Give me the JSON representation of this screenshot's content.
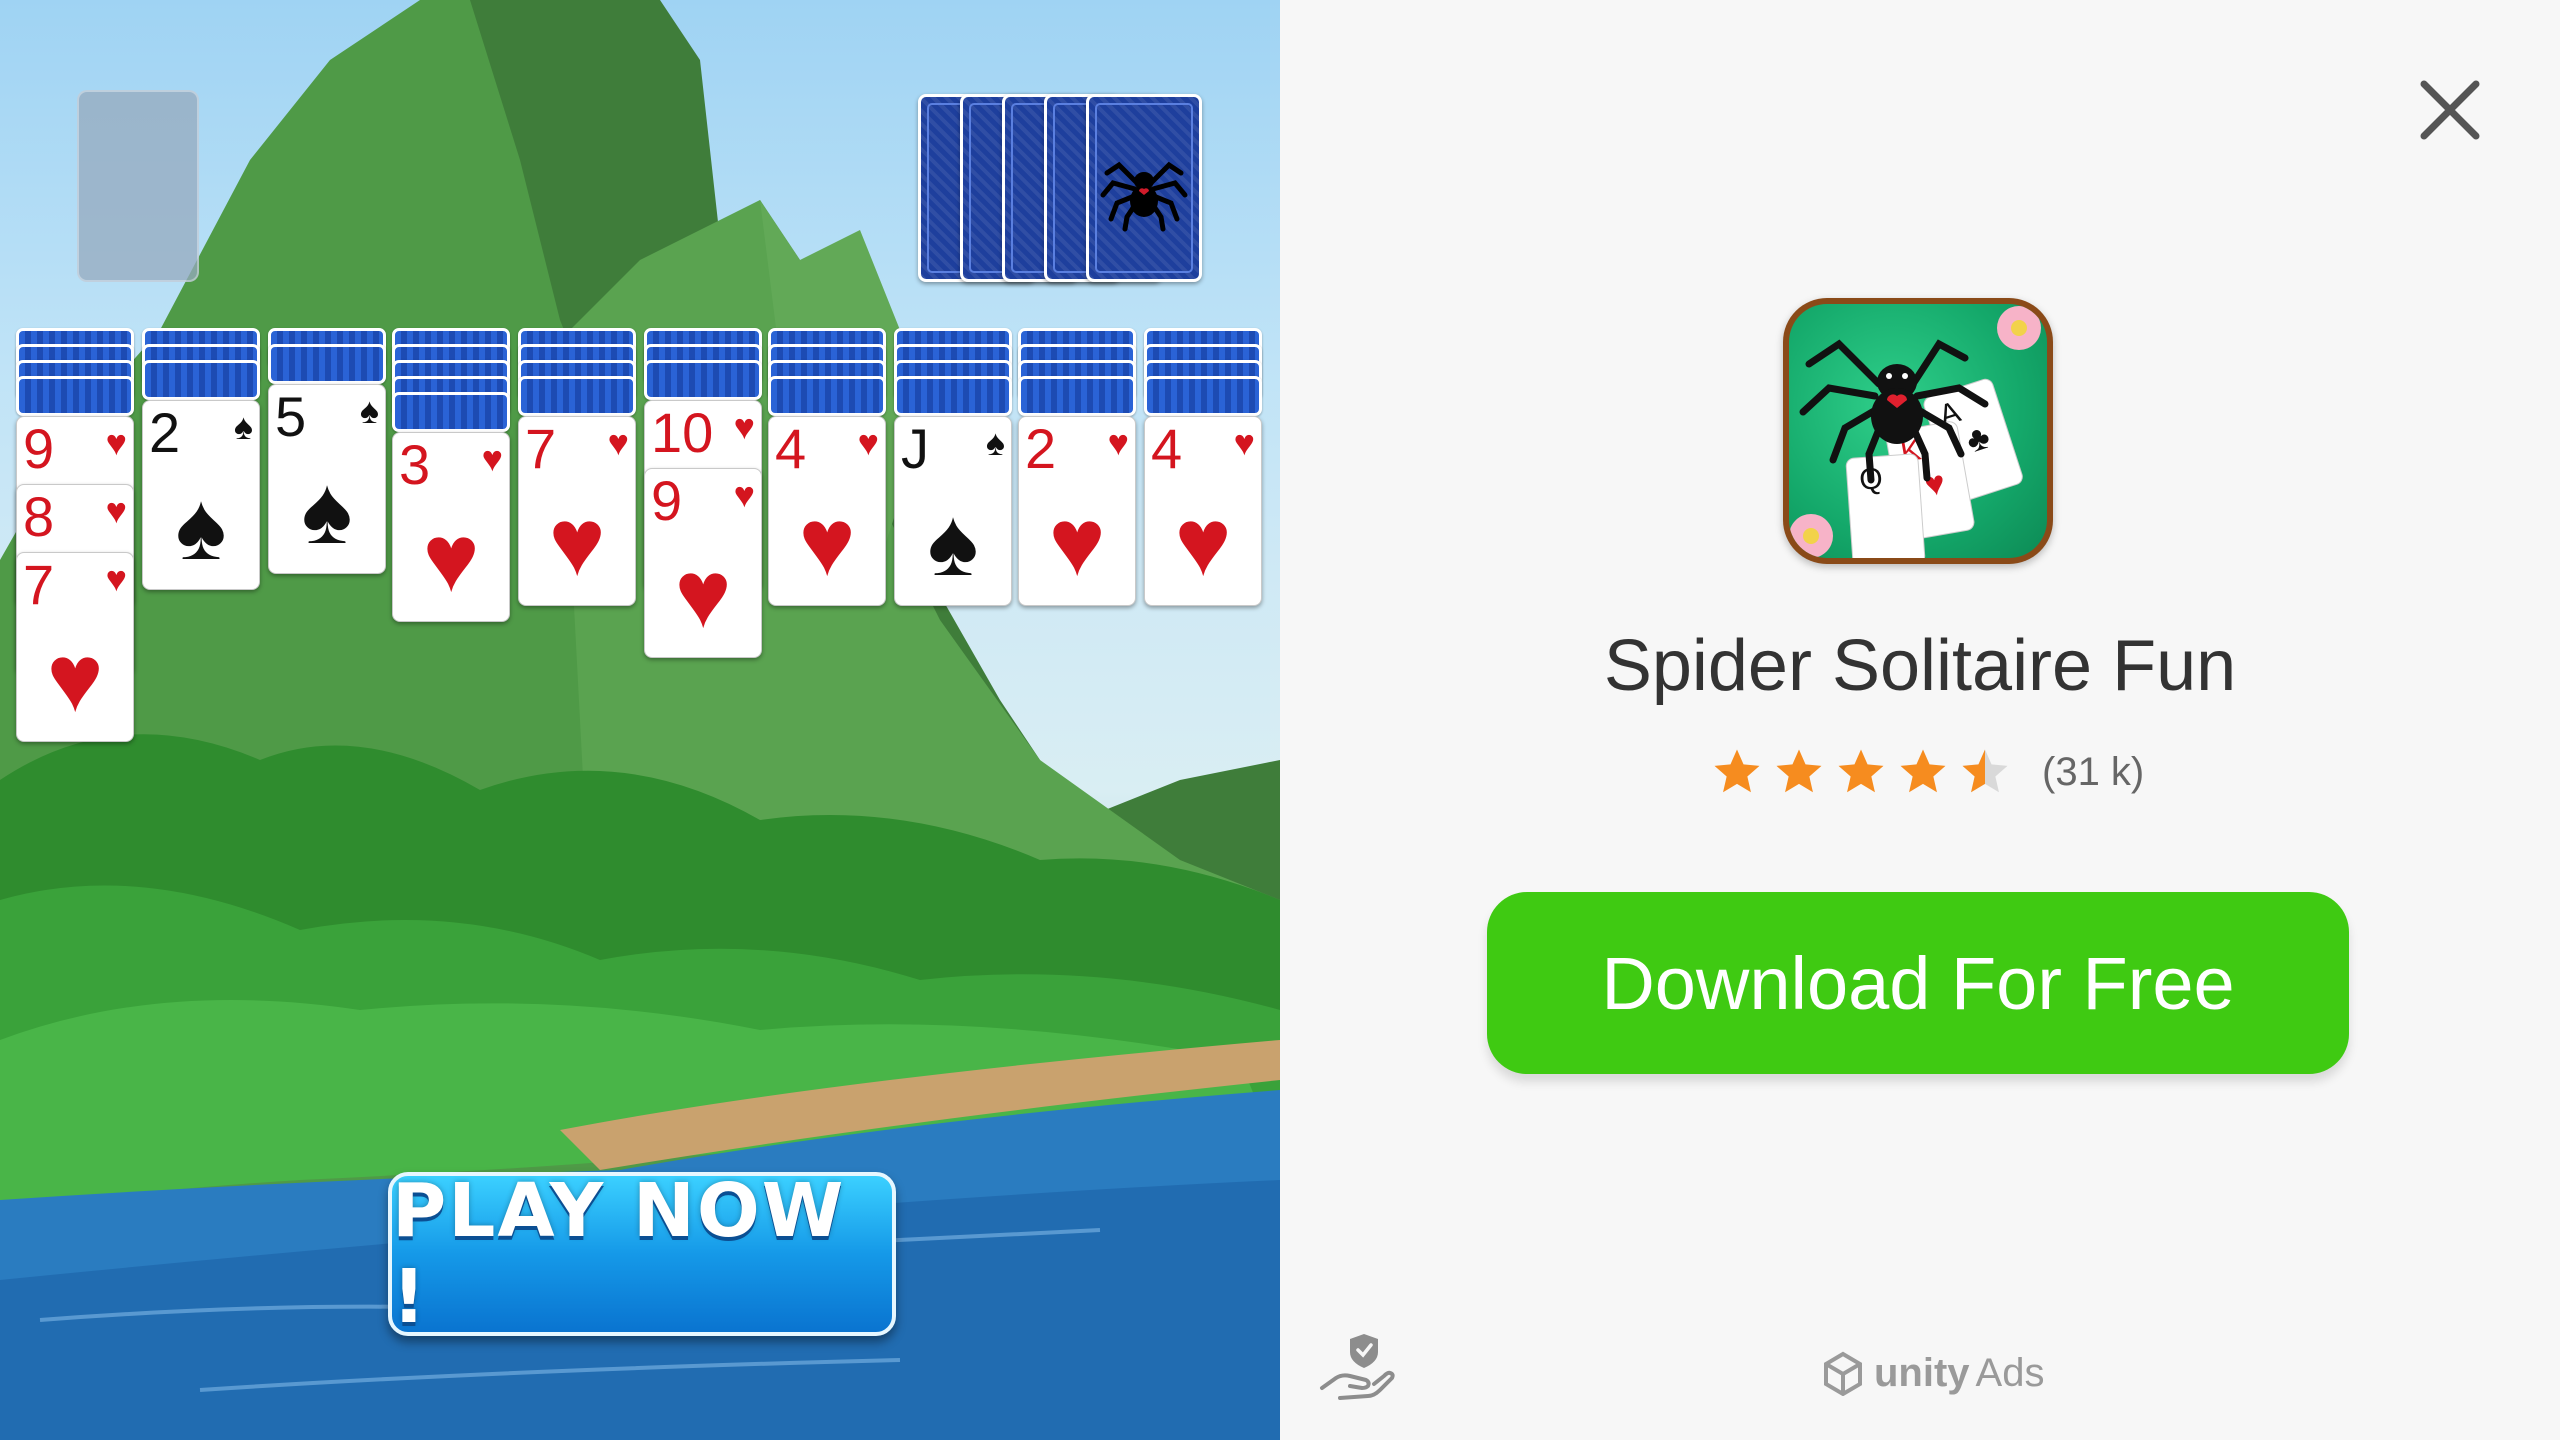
{
  "game": {
    "play_button_label": "PLAY NOW !",
    "columns": [
      {
        "backs": 4,
        "cards": [
          {
            "rank": "9",
            "suit": "♥",
            "color": "red"
          },
          {
            "rank": "8",
            "suit": "♥",
            "color": "red"
          },
          {
            "rank": "7",
            "suit": "♥",
            "color": "red"
          }
        ]
      },
      {
        "backs": 3,
        "cards": [
          {
            "rank": "2",
            "suit": "♠",
            "color": "black"
          }
        ]
      },
      {
        "backs": 2,
        "cards": [
          {
            "rank": "5",
            "suit": "♠",
            "color": "black"
          }
        ]
      },
      {
        "backs": 5,
        "cards": [
          {
            "rank": "3",
            "suit": "♥",
            "color": "red"
          }
        ]
      },
      {
        "backs": 4,
        "cards": [
          {
            "rank": "7",
            "suit": "♥",
            "color": "red"
          }
        ]
      },
      {
        "backs": 3,
        "cards": [
          {
            "rank": "10",
            "suit": "♥",
            "color": "red"
          },
          {
            "rank": "9",
            "suit": "♥",
            "color": "red"
          }
        ]
      },
      {
        "backs": 4,
        "cards": [
          {
            "rank": "4",
            "suit": "♥",
            "color": "red"
          }
        ]
      },
      {
        "backs": 4,
        "cards": [
          {
            "rank": "J",
            "suit": "♠",
            "color": "black"
          }
        ]
      },
      {
        "backs": 4,
        "cards": [
          {
            "rank": "2",
            "suit": "♥",
            "color": "red"
          }
        ]
      },
      {
        "backs": 4,
        "cards": [
          {
            "rank": "4",
            "suit": "♥",
            "color": "red"
          }
        ]
      }
    ],
    "stock_piles": 5
  },
  "ad": {
    "app_name": "Spider Solitaire Fun",
    "rating": 4.5,
    "rating_count": "(31 k)",
    "download_label": "Download For Free",
    "brand_unity": "unity",
    "brand_ads": "Ads",
    "close_icon": "close-icon",
    "privacy_icon": "privacy-hand-shield-icon"
  },
  "colors": {
    "download_green": "#3fca12",
    "star_orange": "#f68c1f",
    "card_back_blue": "#1d4bb3",
    "hearts_red": "#d4151f"
  }
}
